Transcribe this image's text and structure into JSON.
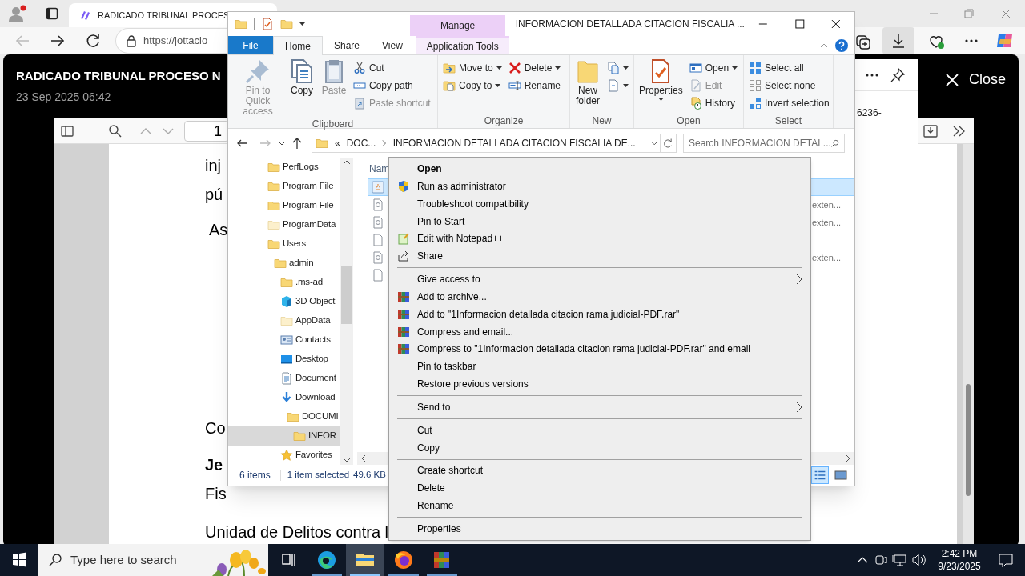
{
  "browser": {
    "tab": {
      "title": "RADICADO TRIBUNAL PROCES"
    },
    "address": "https://jottaclo",
    "viewer": {
      "title": "RADICADO TRIBUNAL PROCESO N",
      "date": "23 Sep 2025 06:42",
      "close": "Close",
      "page_number": "1",
      "flyout_text": "6236-",
      "page_lines": [
        {
          "text": "inj",
          "bold": false
        },
        {
          "text": "pú",
          "bold": false
        },
        {
          "text": "As",
          "bold": false
        },
        {
          "text": "Co",
          "bold": false
        },
        {
          "text": "Je",
          "bold": true
        },
        {
          "text": "Fis",
          "bold": false
        },
        {
          "text": "Unidad de Delitos contra l",
          "bold": false
        }
      ]
    }
  },
  "explorer": {
    "title": "INFORMACION DETALLADA CITACION FISCALIA ...",
    "context_tab": "Manage",
    "tabs": [
      {
        "label": "File",
        "kind": "file",
        "selected": false
      },
      {
        "label": "Home",
        "kind": "tab",
        "selected": true
      },
      {
        "label": "Share",
        "kind": "tab",
        "selected": false
      },
      {
        "label": "View",
        "kind": "tab",
        "selected": false
      },
      {
        "label": "Application Tools",
        "kind": "context",
        "selected": false
      }
    ],
    "ribbon_groups": [
      {
        "label": "Clipboard",
        "columns": [
          {
            "kind": "large",
            "buttons": [
              {
                "label": "Pin to Quick access",
                "kind": "pin",
                "disabled": true
              }
            ]
          },
          {
            "kind": "large",
            "buttons": [
              {
                "label": "Copy",
                "kind": "copy",
                "disabled": false
              }
            ]
          },
          {
            "kind": "large",
            "buttons": [
              {
                "label": "Paste",
                "kind": "paste",
                "disabled": true
              }
            ]
          },
          {
            "kind": "small",
            "buttons": [
              {
                "label": "Cut",
                "kind": "cut",
                "disabled": false
              },
              {
                "label": "Copy path",
                "kind": "copy-path",
                "disabled": false
              },
              {
                "label": "Paste shortcut",
                "kind": "paste-shortcut",
                "disabled": true
              }
            ]
          }
        ]
      },
      {
        "label": "Organize",
        "columns": [
          {
            "kind": "small",
            "buttons": [
              {
                "label": "Move to",
                "kind": "move-to",
                "disabled": false,
                "dropdown": true
              },
              {
                "label": "Copy to",
                "kind": "copy-to",
                "disabled": false,
                "dropdown": true
              }
            ]
          },
          {
            "kind": "small",
            "buttons": [
              {
                "label": "Delete",
                "kind": "delete",
                "disabled": false,
                "dropdown": true
              },
              {
                "label": "Rename",
                "kind": "rename",
                "disabled": false
              }
            ]
          }
        ]
      },
      {
        "label": "New",
        "columns": [
          {
            "kind": "large",
            "buttons": [
              {
                "label": "New folder",
                "kind": "new-folder",
                "disabled": false
              }
            ]
          },
          {
            "kind": "small",
            "buttons": [
              {
                "kind": "new-item",
                "dropdown": true
              },
              {
                "kind": "easy-access",
                "dropdown": true
              }
            ]
          }
        ]
      },
      {
        "label": "Open",
        "columns": [
          {
            "kind": "large",
            "buttons": [
              {
                "label": "Properties",
                "kind": "properties",
                "disabled": false,
                "dropdown": true
              }
            ]
          },
          {
            "kind": "small",
            "buttons": [
              {
                "label": "Open",
                "kind": "open",
                "disabled": false,
                "dropdown": true
              },
              {
                "label": "Edit",
                "kind": "edit",
                "disabled": true
              },
              {
                "label": "History",
                "kind": "history",
                "disabled": false
              }
            ]
          }
        ]
      },
      {
        "label": "Select",
        "columns": [
          {
            "kind": "small",
            "buttons": [
              {
                "label": "Select all",
                "kind": "select-all",
                "disabled": false
              },
              {
                "label": "Select none",
                "kind": "select-none",
                "disabled": false
              },
              {
                "label": "Invert selection",
                "kind": "invert",
                "disabled": false
              }
            ]
          }
        ]
      }
    ],
    "address": {
      "prefix": "«",
      "crumbs": [
        "DOC...",
        "INFORMACION DETALLADA CITACION FISCALIA DE..."
      ]
    },
    "search": {
      "placeholder": "Search INFORMACION DETAL..."
    },
    "nav_tree": [
      {
        "label": "PerfLogs",
        "kind": "folder",
        "selected": false
      },
      {
        "label": "Program File",
        "kind": "folder",
        "selected": false
      },
      {
        "label": "Program File",
        "kind": "folder",
        "selected": false
      },
      {
        "label": "ProgramData",
        "kind": "pale-folder",
        "selected": false
      },
      {
        "label": "Users",
        "kind": "folder",
        "selected": false,
        "children": [
          {
            "label": "admin",
            "kind": "folder",
            "selected": false,
            "children": [
              {
                "label": ".ms-ad",
                "kind": "folder",
                "selected": false
              },
              {
                "label": "3D Object",
                "kind": "cube",
                "selected": false
              },
              {
                "label": "AppData",
                "kind": "pale-folder",
                "selected": false
              },
              {
                "label": "Contacts",
                "kind": "contacts",
                "selected": false
              },
              {
                "label": "Desktop",
                "kind": "desktop",
                "selected": false
              },
              {
                "label": "Document",
                "kind": "documents",
                "selected": false
              },
              {
                "label": "Download",
                "kind": "download",
                "selected": false,
                "children": [
                  {
                    "label": "DOCUMI",
                    "kind": "folder",
                    "selected": false,
                    "children": [
                      {
                        "label": "INFOR",
                        "kind": "folder",
                        "selected": true
                      }
                    ]
                  }
                ]
              },
              {
                "label": "Favorites",
                "kind": "star",
                "selected": false
              }
            ]
          }
        ]
      }
    ],
    "file_list": {
      "column": "Nam",
      "rows": [
        {
          "kind": "exe",
          "selected": true
        },
        {
          "kind": "config",
          "type": "exten...",
          "selected": false
        },
        {
          "kind": "config",
          "type": "exten...",
          "selected": false
        },
        {
          "kind": "blank",
          "selected": false
        },
        {
          "kind": "config",
          "type": "exten...",
          "selected": false
        },
        {
          "kind": "blank",
          "selected": false
        }
      ]
    },
    "status_bar": {
      "count": "6 items",
      "selection": "1 item selected",
      "size": "49.6 KB"
    }
  },
  "context_menu": {
    "items": [
      {
        "label": "Open",
        "kind": "default"
      },
      {
        "label": "Run as administrator",
        "kind": "shield"
      },
      {
        "label": "Troubleshoot compatibility",
        "kind": "plain"
      },
      {
        "label": "Pin to Start",
        "kind": "plain"
      },
      {
        "label": "Edit with Notepad++",
        "kind": "notepad"
      },
      {
        "label": "Share",
        "kind": "share"
      },
      {
        "kind": "separator"
      },
      {
        "label": "Give access to",
        "kind": "submenu"
      },
      {
        "label": "Add to archive...",
        "kind": "archive"
      },
      {
        "label": "Add to \"1Informacion detallada citacion rama judicial-PDF.rar\"",
        "kind": "archive"
      },
      {
        "label": "Compress and email...",
        "kind": "archive"
      },
      {
        "label": "Compress to \"1Informacion detallada citacion rama judicial-PDF.rar\" and email",
        "kind": "archive"
      },
      {
        "label": "Pin to taskbar",
        "kind": "plain"
      },
      {
        "label": "Restore previous versions",
        "kind": "plain"
      },
      {
        "kind": "separator"
      },
      {
        "label": "Send to",
        "kind": "submenu"
      },
      {
        "kind": "separator"
      },
      {
        "label": "Cut",
        "kind": "plain"
      },
      {
        "label": "Copy",
        "kind": "plain"
      },
      {
        "kind": "separator"
      },
      {
        "label": "Create shortcut",
        "kind": "plain"
      },
      {
        "label": "Delete",
        "kind": "plain"
      },
      {
        "label": "Rename",
        "kind": "plain"
      },
      {
        "kind": "separator"
      },
      {
        "label": "Properties",
        "kind": "plain"
      }
    ]
  },
  "taskbar": {
    "search_placeholder": "Type here to search",
    "apps": [
      {
        "kind": "task-view",
        "active": false
      },
      {
        "kind": "edge",
        "active": false
      },
      {
        "kind": "explorer",
        "active": true
      },
      {
        "kind": "firefox",
        "active": false
      },
      {
        "kind": "winrar",
        "active": false
      }
    ],
    "time": "2:42 PM",
    "date": "9/23/2025"
  }
}
